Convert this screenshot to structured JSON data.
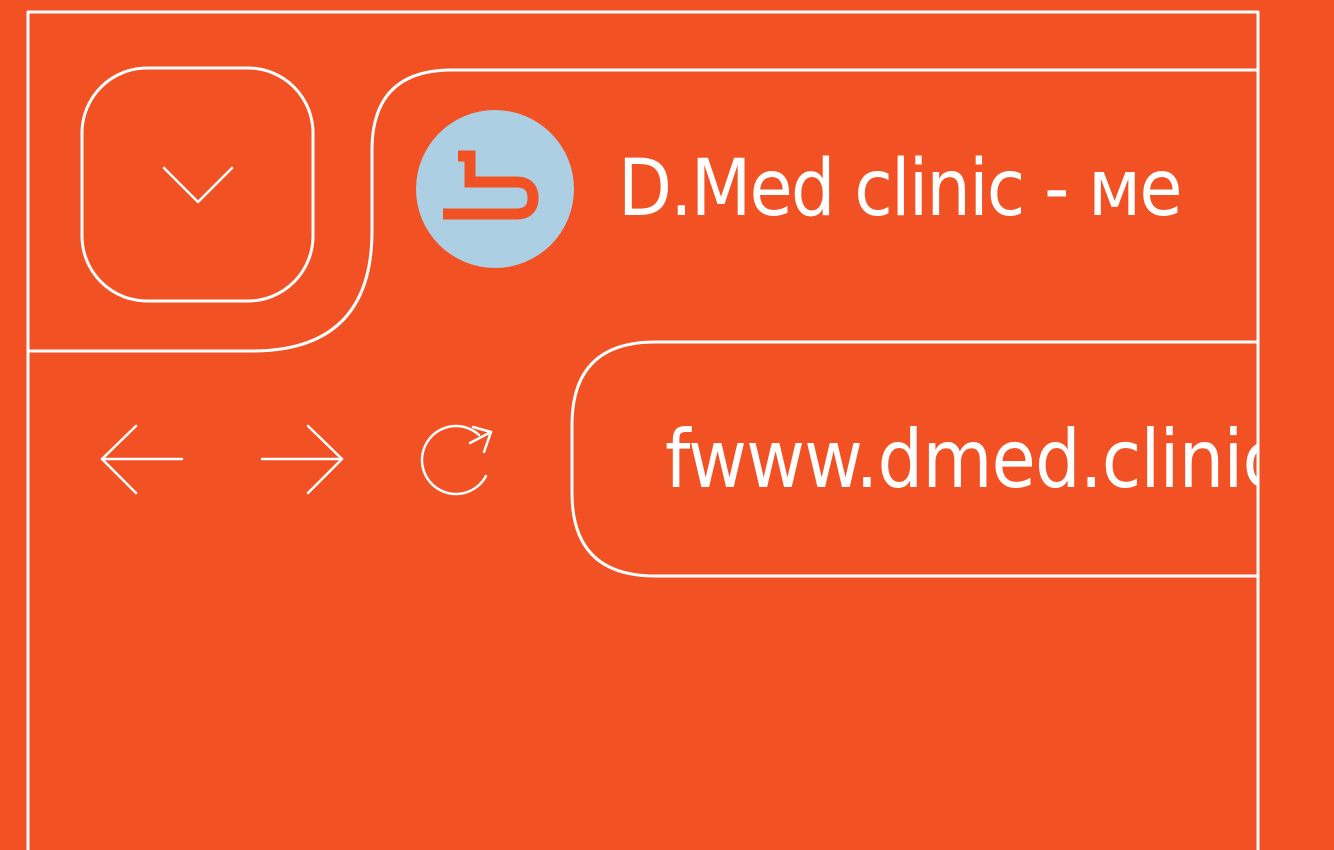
{
  "tab": {
    "title": "D.Med clinic - ме",
    "favicon": "dmed-clinic-logo-icon",
    "favicon_bg": "#ACCFE3"
  },
  "tab_dropdown": {
    "icon": "chevron-down-icon"
  },
  "navigation": {
    "back_icon": "arrow-left-icon",
    "forward_icon": "arrow-right-icon",
    "reload_icon": "reload-icon"
  },
  "address_bar": {
    "url": "fwww.dmed.clinic"
  },
  "colors": {
    "background": "#F25124",
    "outline": "#FFFFFF",
    "favicon_accent": "#F25124"
  }
}
